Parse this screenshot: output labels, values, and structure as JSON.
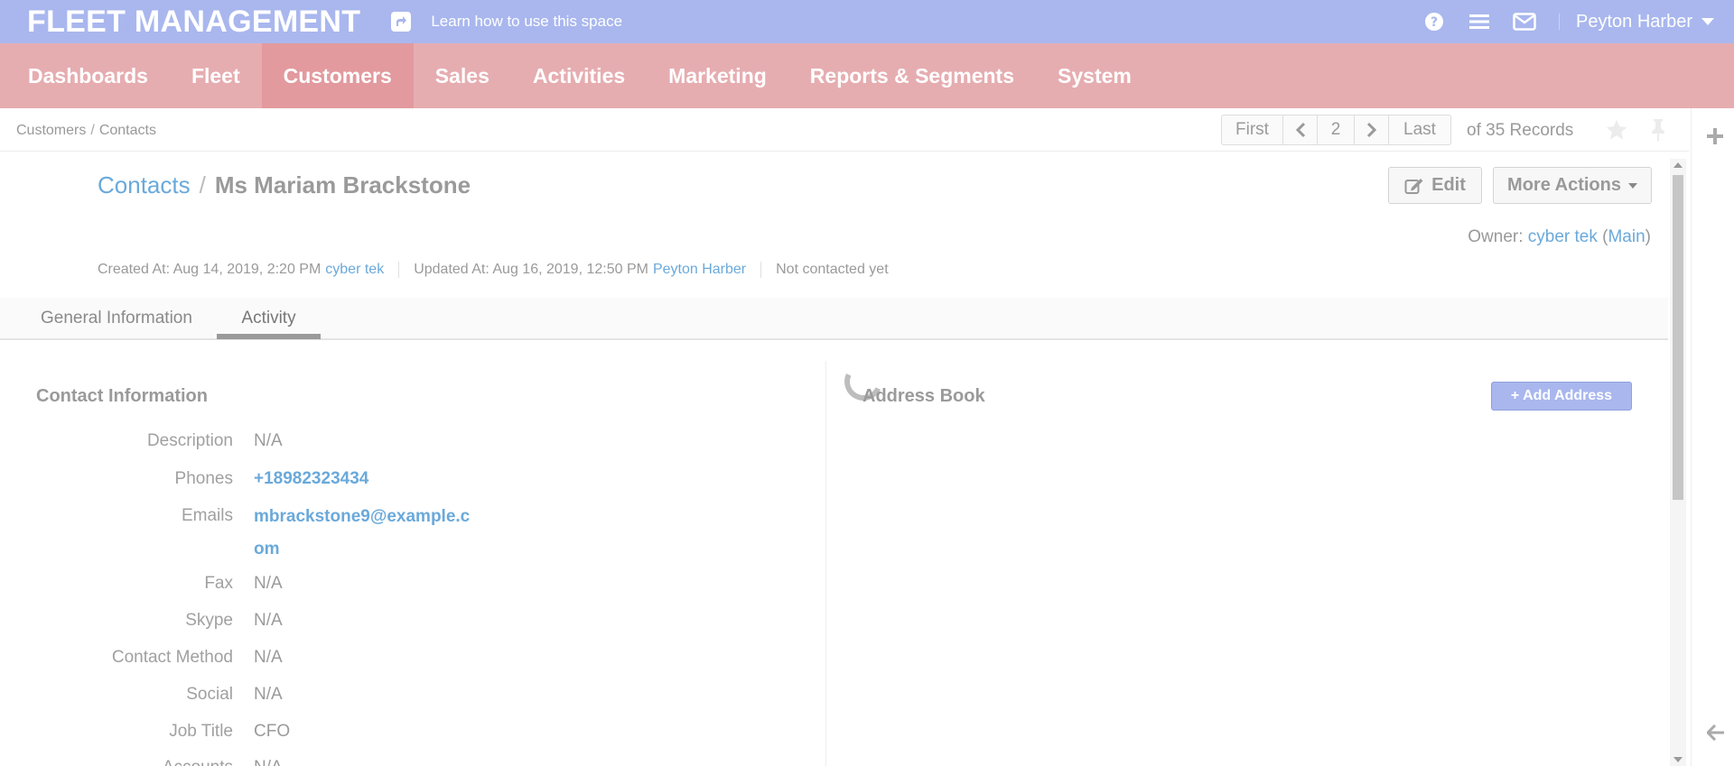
{
  "header": {
    "app_title": "FLEET MANAGEMENT",
    "learn_link": "Learn how to use this space",
    "user_name": "Peyton Harber",
    "icons": [
      "share-icon",
      "help-icon",
      "tasks-menu-icon",
      "mail-icon",
      "chevron-down-icon"
    ]
  },
  "nav": {
    "items": [
      {
        "label": "Dashboards"
      },
      {
        "label": "Fleet"
      },
      {
        "label": "Customers"
      },
      {
        "label": "Sales"
      },
      {
        "label": "Activities"
      },
      {
        "label": "Marketing"
      },
      {
        "label": "Reports & Segments"
      },
      {
        "label": "System"
      }
    ],
    "active": "Customers"
  },
  "breadcrumb": {
    "parent": "Customers",
    "separator": "/",
    "current": "Contacts"
  },
  "pager": {
    "first": "First",
    "page": "2",
    "last": "Last",
    "records": "of 35 Records"
  },
  "page": {
    "entity_link": "Contacts",
    "separator": "/",
    "record_name": "Ms Mariam Brackstone",
    "edit_label": "Edit",
    "more_actions_label": "More Actions",
    "owner_label": "Owner:",
    "owner_name": "cyber tek",
    "owner_bu_open": "(",
    "owner_bu": "Main",
    "owner_bu_close": ")",
    "created_label": "Created At: Aug 14, 2019, 2:20 PM",
    "created_by": "cyber tek",
    "updated_label": "Updated At: Aug 16, 2019, 12:50 PM",
    "updated_by": "Peyton Harber",
    "contacted_status": "Not contacted yet"
  },
  "tabs": [
    {
      "label": "General Information"
    },
    {
      "label": "Activity"
    }
  ],
  "active_tab": "Activity",
  "contact_info": {
    "title": "Contact Information",
    "fields": [
      {
        "label": "Description",
        "value": "N/A"
      },
      {
        "label": "Phones",
        "value": "+18982323434"
      },
      {
        "label": "Emails",
        "value": "mbrackstone9@example.com"
      },
      {
        "label": "Fax",
        "value": "N/A"
      },
      {
        "label": "Skype",
        "value": "N/A"
      },
      {
        "label": "Contact Method",
        "value": "N/A"
      },
      {
        "label": "Social",
        "value": "N/A"
      },
      {
        "label": "Job Title",
        "value": "CFO"
      },
      {
        "label": "Accounts",
        "value": "N/A"
      }
    ]
  },
  "address_book": {
    "title": "Address Book",
    "add_label": "+ Add Address"
  },
  "colors": {
    "header_bg": "#a9b7ee",
    "nav_bg": "#e6adb1",
    "nav_active_bg": "#e29a9e",
    "link": "#6aa9da"
  }
}
